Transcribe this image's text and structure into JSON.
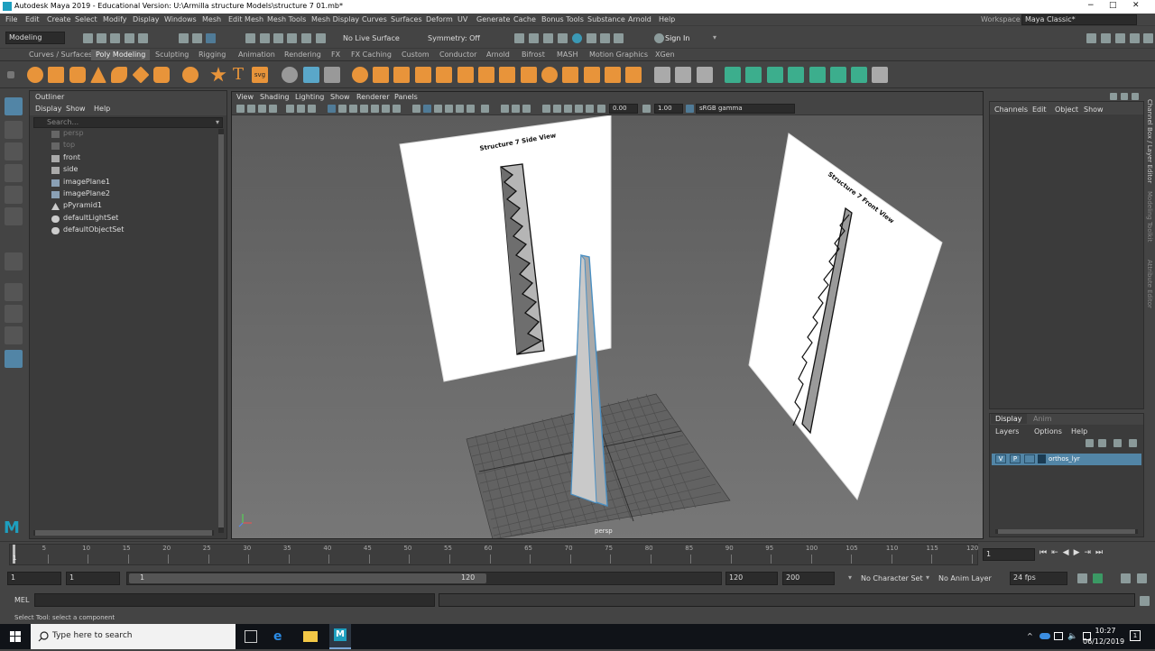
{
  "window": {
    "title": "Autodesk Maya 2019 - Educational Version: U:\\Armilla structure Models\\structure 7 01.mb*",
    "min": "−",
    "max": "□",
    "close": "✕"
  },
  "menubar": {
    "items": [
      "File",
      "Edit",
      "Create",
      "Select",
      "Modify",
      "Display",
      "Windows",
      "Mesh",
      "Edit Mesh",
      "Mesh Tools",
      "Mesh Display",
      "Curves",
      "Surfaces",
      "Deform",
      "UV",
      "Generate",
      "Cache",
      "Bonus Tools",
      "Substance",
      "Arnold",
      "Help"
    ],
    "workspace_label": "Workspace :",
    "workspace_value": "Maya Classic*"
  },
  "statusline": {
    "mode": "Modeling",
    "live_surface": "No Live Surface",
    "symmetry": "Symmetry: Off",
    "sign_in": "Sign In"
  },
  "shelf": {
    "tabs": [
      "Curves / Surfaces",
      "Poly Modeling",
      "Sculpting",
      "Rigging",
      "Animation",
      "Rendering",
      "FX",
      "FX Caching",
      "Custom",
      "Conductor",
      "Arnold",
      "Bifrost",
      "MASH",
      "Motion Graphics",
      "XGen"
    ],
    "active_tab": "Poly Modeling"
  },
  "outliner": {
    "title": "Outliner",
    "menu": [
      "Display",
      "Show",
      "Help"
    ],
    "search_placeholder": "Search...",
    "items": [
      {
        "label": "persp",
        "dim": true,
        "icon": "camera-icon"
      },
      {
        "label": "top",
        "dim": true,
        "icon": "camera-icon"
      },
      {
        "label": "front",
        "dim": false,
        "icon": "camera-icon"
      },
      {
        "label": "side",
        "dim": false,
        "icon": "camera-icon"
      },
      {
        "label": "imagePlane1",
        "dim": false,
        "icon": "image-plane-icon"
      },
      {
        "label": "imagePlane2",
        "dim": false,
        "icon": "image-plane-icon"
      },
      {
        "label": "pPyramid1",
        "dim": false,
        "icon": "mesh-icon"
      },
      {
        "label": "defaultLightSet",
        "dim": false,
        "icon": "set-icon"
      },
      {
        "label": "defaultObjectSet",
        "dim": false,
        "icon": "set-icon"
      }
    ]
  },
  "viewport": {
    "menu": [
      "View",
      "Shading",
      "Lighting",
      "Show",
      "Renderer",
      "Panels"
    ],
    "exposure": "0.00",
    "gamma": "1.00",
    "color_space": "sRGB gamma",
    "camera_label": "persp",
    "side_plane_title": "Structure 7 Side View",
    "front_plane_title": "Structure 7 Front View"
  },
  "channelbox": {
    "menu": [
      "Channels",
      "Edit",
      "Object",
      "Show"
    ]
  },
  "layers": {
    "tabs": [
      "Display",
      "Anim"
    ],
    "active_tab": "Display",
    "menu": [
      "Layers",
      "Options",
      "Help"
    ],
    "layer_v": "V",
    "layer_p": "P",
    "layer_name": "orthos_lyr"
  },
  "sidetabs": [
    "Channel Box / Layer Editor",
    "Modeling Toolkit",
    "Attribute Editor"
  ],
  "timeslider": {
    "ticks": [
      "5",
      "10",
      "15",
      "20",
      "25",
      "30",
      "35",
      "40",
      "45",
      "50",
      "55",
      "60",
      "65",
      "70",
      "75",
      "80",
      "85",
      "90",
      "95",
      "100",
      "105",
      "110",
      "115",
      "120"
    ],
    "current_marker": "1",
    "current_frame": "1"
  },
  "range": {
    "start": "1",
    "playback_start": "1",
    "slider_start": "1",
    "slider_end": "120",
    "playback_end": "120",
    "end": "200",
    "character_set": "No Character Set",
    "anim_layer": "No Anim Layer",
    "fps": "24 fps"
  },
  "cmdline": {
    "label": "MEL"
  },
  "helpline": {
    "text": "Select Tool: select a component"
  },
  "taskbar": {
    "search_placeholder": "Type here to search",
    "time": "10:27",
    "date": "06/12/2019",
    "notification_count": "1"
  },
  "colors": {
    "accent": "#5285a6",
    "selection": "#4a8fc2",
    "viewport_bg": "#6e6e6e"
  }
}
